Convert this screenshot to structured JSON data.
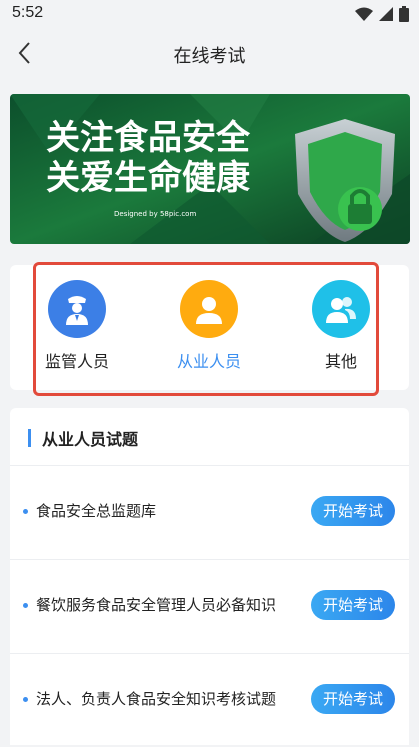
{
  "status": {
    "time": "5:52"
  },
  "navbar": {
    "title": "在线考试"
  },
  "banner": {
    "line1": "关注食品安全",
    "line2": "关爱生命健康",
    "credit": "Designed by 58pic.com"
  },
  "categories": [
    {
      "label": "监管人员",
      "icon": "police-officer-icon",
      "color": "#3c7fe6",
      "active": false
    },
    {
      "label": "从业人员",
      "icon": "person-icon",
      "color": "#ffab0f",
      "active": true
    },
    {
      "label": "其他",
      "icon": "people-icon",
      "color": "#1fc0e8",
      "active": false
    }
  ],
  "section": {
    "title": "从业人员试题"
  },
  "exams": [
    {
      "title": "食品安全总监题库",
      "button": "开始考试"
    },
    {
      "title": "餐饮服务食品安全管理人员必备知识",
      "button": "开始考试"
    },
    {
      "title": "法人、负责人食品安全知识考核试题",
      "button": "开始考试"
    }
  ],
  "colors": {
    "accent": "#3c8ff0",
    "highlight_outline": "#e24a3b"
  }
}
